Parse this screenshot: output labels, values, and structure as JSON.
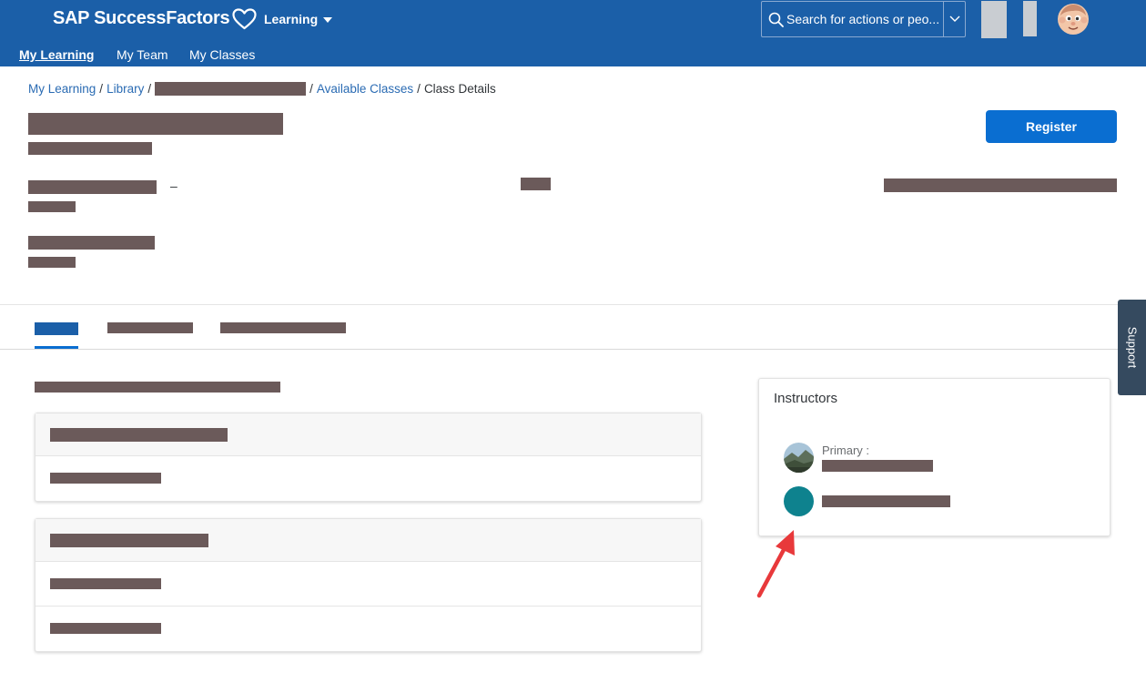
{
  "header": {
    "logo_text": "SAP SuccessFactors",
    "module_label": "Learning",
    "search_placeholder": "Search for actions or peo...",
    "brand_color": "#1b5fa8"
  },
  "subnav": {
    "items": [
      {
        "label": "My Learning",
        "active": true
      },
      {
        "label": "My Team",
        "active": false
      },
      {
        "label": "My Classes",
        "active": false
      }
    ]
  },
  "breadcrumb": {
    "items": [
      "My Learning",
      "Library",
      "Available Classes"
    ],
    "current": "Class Details",
    "separator": "/"
  },
  "actions": {
    "register_label": "Register",
    "button_color": "#0a6ed1"
  },
  "class_details": {
    "date_separator": "–"
  },
  "support": {
    "label": "Support"
  },
  "instructors": {
    "title": "Instructors",
    "primary_label": "Primary :",
    "avatar_color": "#0e828e"
  },
  "icons": [
    "heart-icon",
    "chevron-down-icon",
    "search-icon",
    "user-avatar-icon",
    "instructor-photo",
    "instructor-avatar",
    "annotation-arrow"
  ]
}
